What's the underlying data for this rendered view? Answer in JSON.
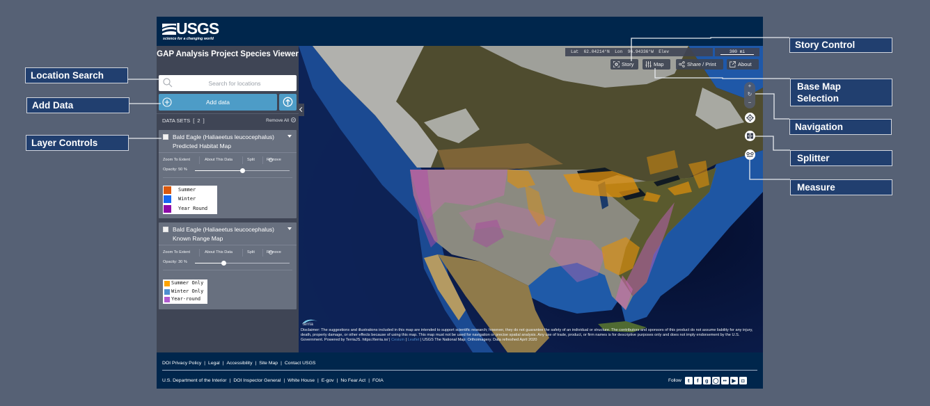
{
  "header": {
    "logo_text": "USGS",
    "logo_tagline": "science for a changing world"
  },
  "sidebar": {
    "title": "GAP Analysis Project Species Viewer",
    "search": {
      "placeholder": "Search for locations",
      "value": ""
    },
    "add_data_label": "Add data",
    "datasets_label": "DATA SETS",
    "datasets_count": "[ 2 ]",
    "remove_all_label": "Remove All",
    "layers": [
      {
        "title_line1": "Bald Eagle (Haliaeetus leucocephalus)",
        "title_line2": "Predicted Habitat Map",
        "checked": false,
        "actions": {
          "zoom": "Zoom To Extent",
          "about": "About This Data",
          "split": "Split",
          "remove": "Remove"
        },
        "opacity_label": "Opacity: 50 %",
        "opacity_percent": 50,
        "legend": [
          {
            "label": "Summer",
            "color": "#d9590e"
          },
          {
            "label": "Winter",
            "color": "#1566f0"
          },
          {
            "label": "Year Round",
            "color": "#8e0aa8"
          }
        ]
      },
      {
        "title_line1": "Bald Eagle (Haliaeetus leucocephalus)",
        "title_line2": "Known Range Map",
        "checked": false,
        "actions": {
          "zoom": "Zoom To Extent",
          "about": "About This Data",
          "split": "Split",
          "remove": "Remove"
        },
        "opacity_label": "Opacity: 30 %",
        "opacity_percent": 30,
        "legend": [
          {
            "label": "Summer Only",
            "color": "#ffa500"
          },
          {
            "label": "Winter Only",
            "color": "#4f8fd0"
          },
          {
            "label": "Year-round",
            "color": "#b05ad0"
          }
        ]
      }
    ]
  },
  "map": {
    "coordinates": "Lat  62.04214°N  Lon  96.94336°W  Elev",
    "scale_label": "300 mi",
    "buttons": {
      "story": "Story",
      "map": "Map",
      "share": "Share / Print",
      "about": "About"
    },
    "zoom": {
      "in": "+",
      "reset": "↻",
      "out": "−"
    },
    "terria_logo_text": "terria",
    "disclaimer_text": "Disclaimer: The suggestions and illustrations included in this map are intended to support scientific research; however, they do not guarantee the safety of an individual or structure. The contributors and sponsors of this product do not assume liability for any injury, death, property damage, or other effects because of using this map. This map must not be used for navigation or precise spatial analysis. Any use of trade, product, or firm names is for descriptive purposes only and does not imply endorsement by the U.S. Government. Powered by TerriaJS. https://terria.io/ | ",
    "disclaimer_links": [
      "Cesium",
      "Leaflet"
    ],
    "disclaimer_tail": " | USGS The National Map: Orthoimagery. Data refreshed April 2020"
  },
  "footer": {
    "row1": [
      "DOI Privacy Policy",
      "Legal",
      "Accessibility",
      "Site Map",
      "Contact USGS"
    ],
    "row2": [
      "U.S. Department of the Interior",
      "DOI Inspector General",
      "White House",
      "E-gov",
      "No Fear Act",
      "FOIA"
    ],
    "follow_label": "Follow",
    "social": [
      {
        "name": "twitter",
        "glyph": "t"
      },
      {
        "name": "facebook",
        "glyph": "f"
      },
      {
        "name": "google-plus",
        "glyph": "g"
      },
      {
        "name": "github",
        "glyph": "◯"
      },
      {
        "name": "flickr",
        "glyph": "••"
      },
      {
        "name": "youtube",
        "glyph": "▶"
      },
      {
        "name": "instagram",
        "glyph": "◘"
      }
    ]
  },
  "callouts": {
    "location_search": "Location Search",
    "add_data": "Add Data",
    "layer_controls": "Layer Controls",
    "story_control": "Story Control",
    "base_map_line1": "Base Map",
    "base_map_line2": "Selection",
    "navigation": "Navigation",
    "splitter": "Splitter",
    "measure": "Measure"
  }
}
